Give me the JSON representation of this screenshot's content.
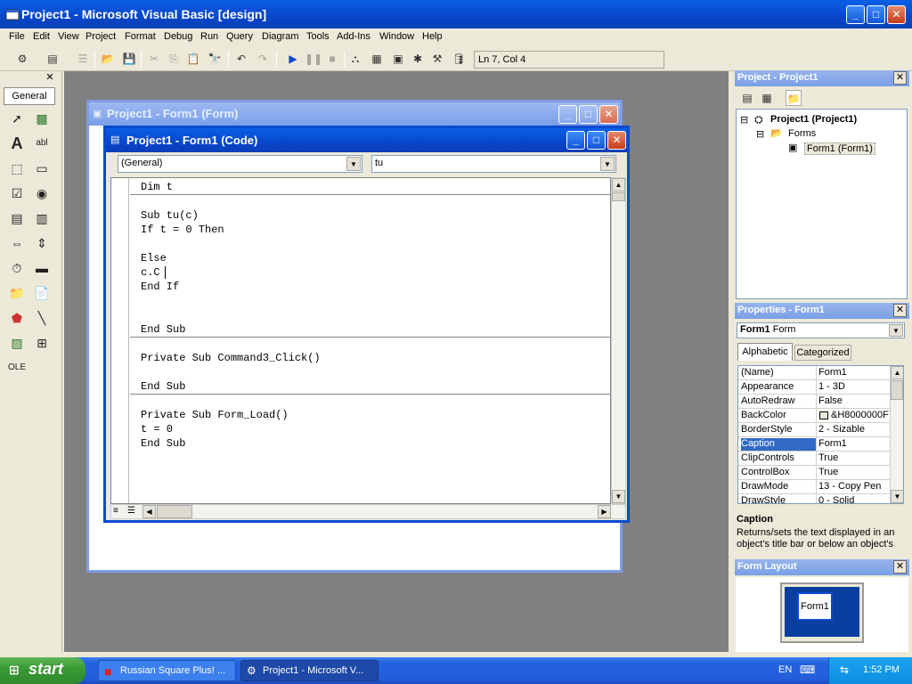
{
  "window": {
    "title": "Project1 - Microsoft Visual Basic [design]"
  },
  "menu": [
    "File",
    "Edit",
    "View",
    "Project",
    "Format",
    "Debug",
    "Run",
    "Query",
    "Diagram",
    "Tools",
    "Add-Ins",
    "Window",
    "Help"
  ],
  "toolbar": {
    "status": "Ln 7, Col 4"
  },
  "toolbox": {
    "tab_label": "General"
  },
  "form_window": {
    "title": "Project1 - Form1 (Form)"
  },
  "code_window": {
    "title": "Project1 - Form1 (Code)",
    "object_combo": "(General)",
    "proc_combo": "tu",
    "lines": [
      "Dim t",
      "Sub tu(c)",
      "If t = 0 Then",
      "Else",
      "c.C",
      "End If",
      "End Sub",
      "Private Sub Command3_Click()",
      "End Sub",
      "Private Sub Form_Load()",
      "t = 0",
      "End Sub"
    ]
  },
  "project_panel": {
    "title": "Project - Project1",
    "tree": {
      "root": "Project1 (Project1)",
      "folder": "Forms",
      "form": "Form1 (Form1)"
    }
  },
  "properties_panel": {
    "title": "Properties - Form1",
    "object_name": "Form1",
    "object_type": "Form",
    "tab_alphabetic": "Alphabetic",
    "tab_categorized": "Categorized",
    "rows": [
      {
        "k": "(Name)",
        "v": "Form1"
      },
      {
        "k": "Appearance",
        "v": "1 - 3D"
      },
      {
        "k": "AutoRedraw",
        "v": "False"
      },
      {
        "k": "BackColor",
        "v": "&H8000000F"
      },
      {
        "k": "BorderStyle",
        "v": "2 - Sizable"
      },
      {
        "k": "Caption",
        "v": "Form1"
      },
      {
        "k": "ClipControls",
        "v": "True"
      },
      {
        "k": "ControlBox",
        "v": "True"
      },
      {
        "k": "DrawMode",
        "v": "13 - Copy Pen"
      },
      {
        "k": "DrawStyle",
        "v": "0 - Solid"
      }
    ],
    "desc_title": "Caption",
    "desc_text": "Returns/sets the text displayed in an object's title bar or below an object's"
  },
  "layout_panel": {
    "title": "Form Layout",
    "preview_label": "Form1"
  },
  "taskbar": {
    "start": "start",
    "items": [
      "Russian Square Plus! ...",
      "Project1 - Microsoft V..."
    ],
    "lang": "EN",
    "clock": "1:52 PM"
  },
  "colors": {
    "titlebar": "#0a49d0",
    "selection": "#316ac5",
    "workspace": "#808080",
    "start_green": "#3a9a35"
  }
}
